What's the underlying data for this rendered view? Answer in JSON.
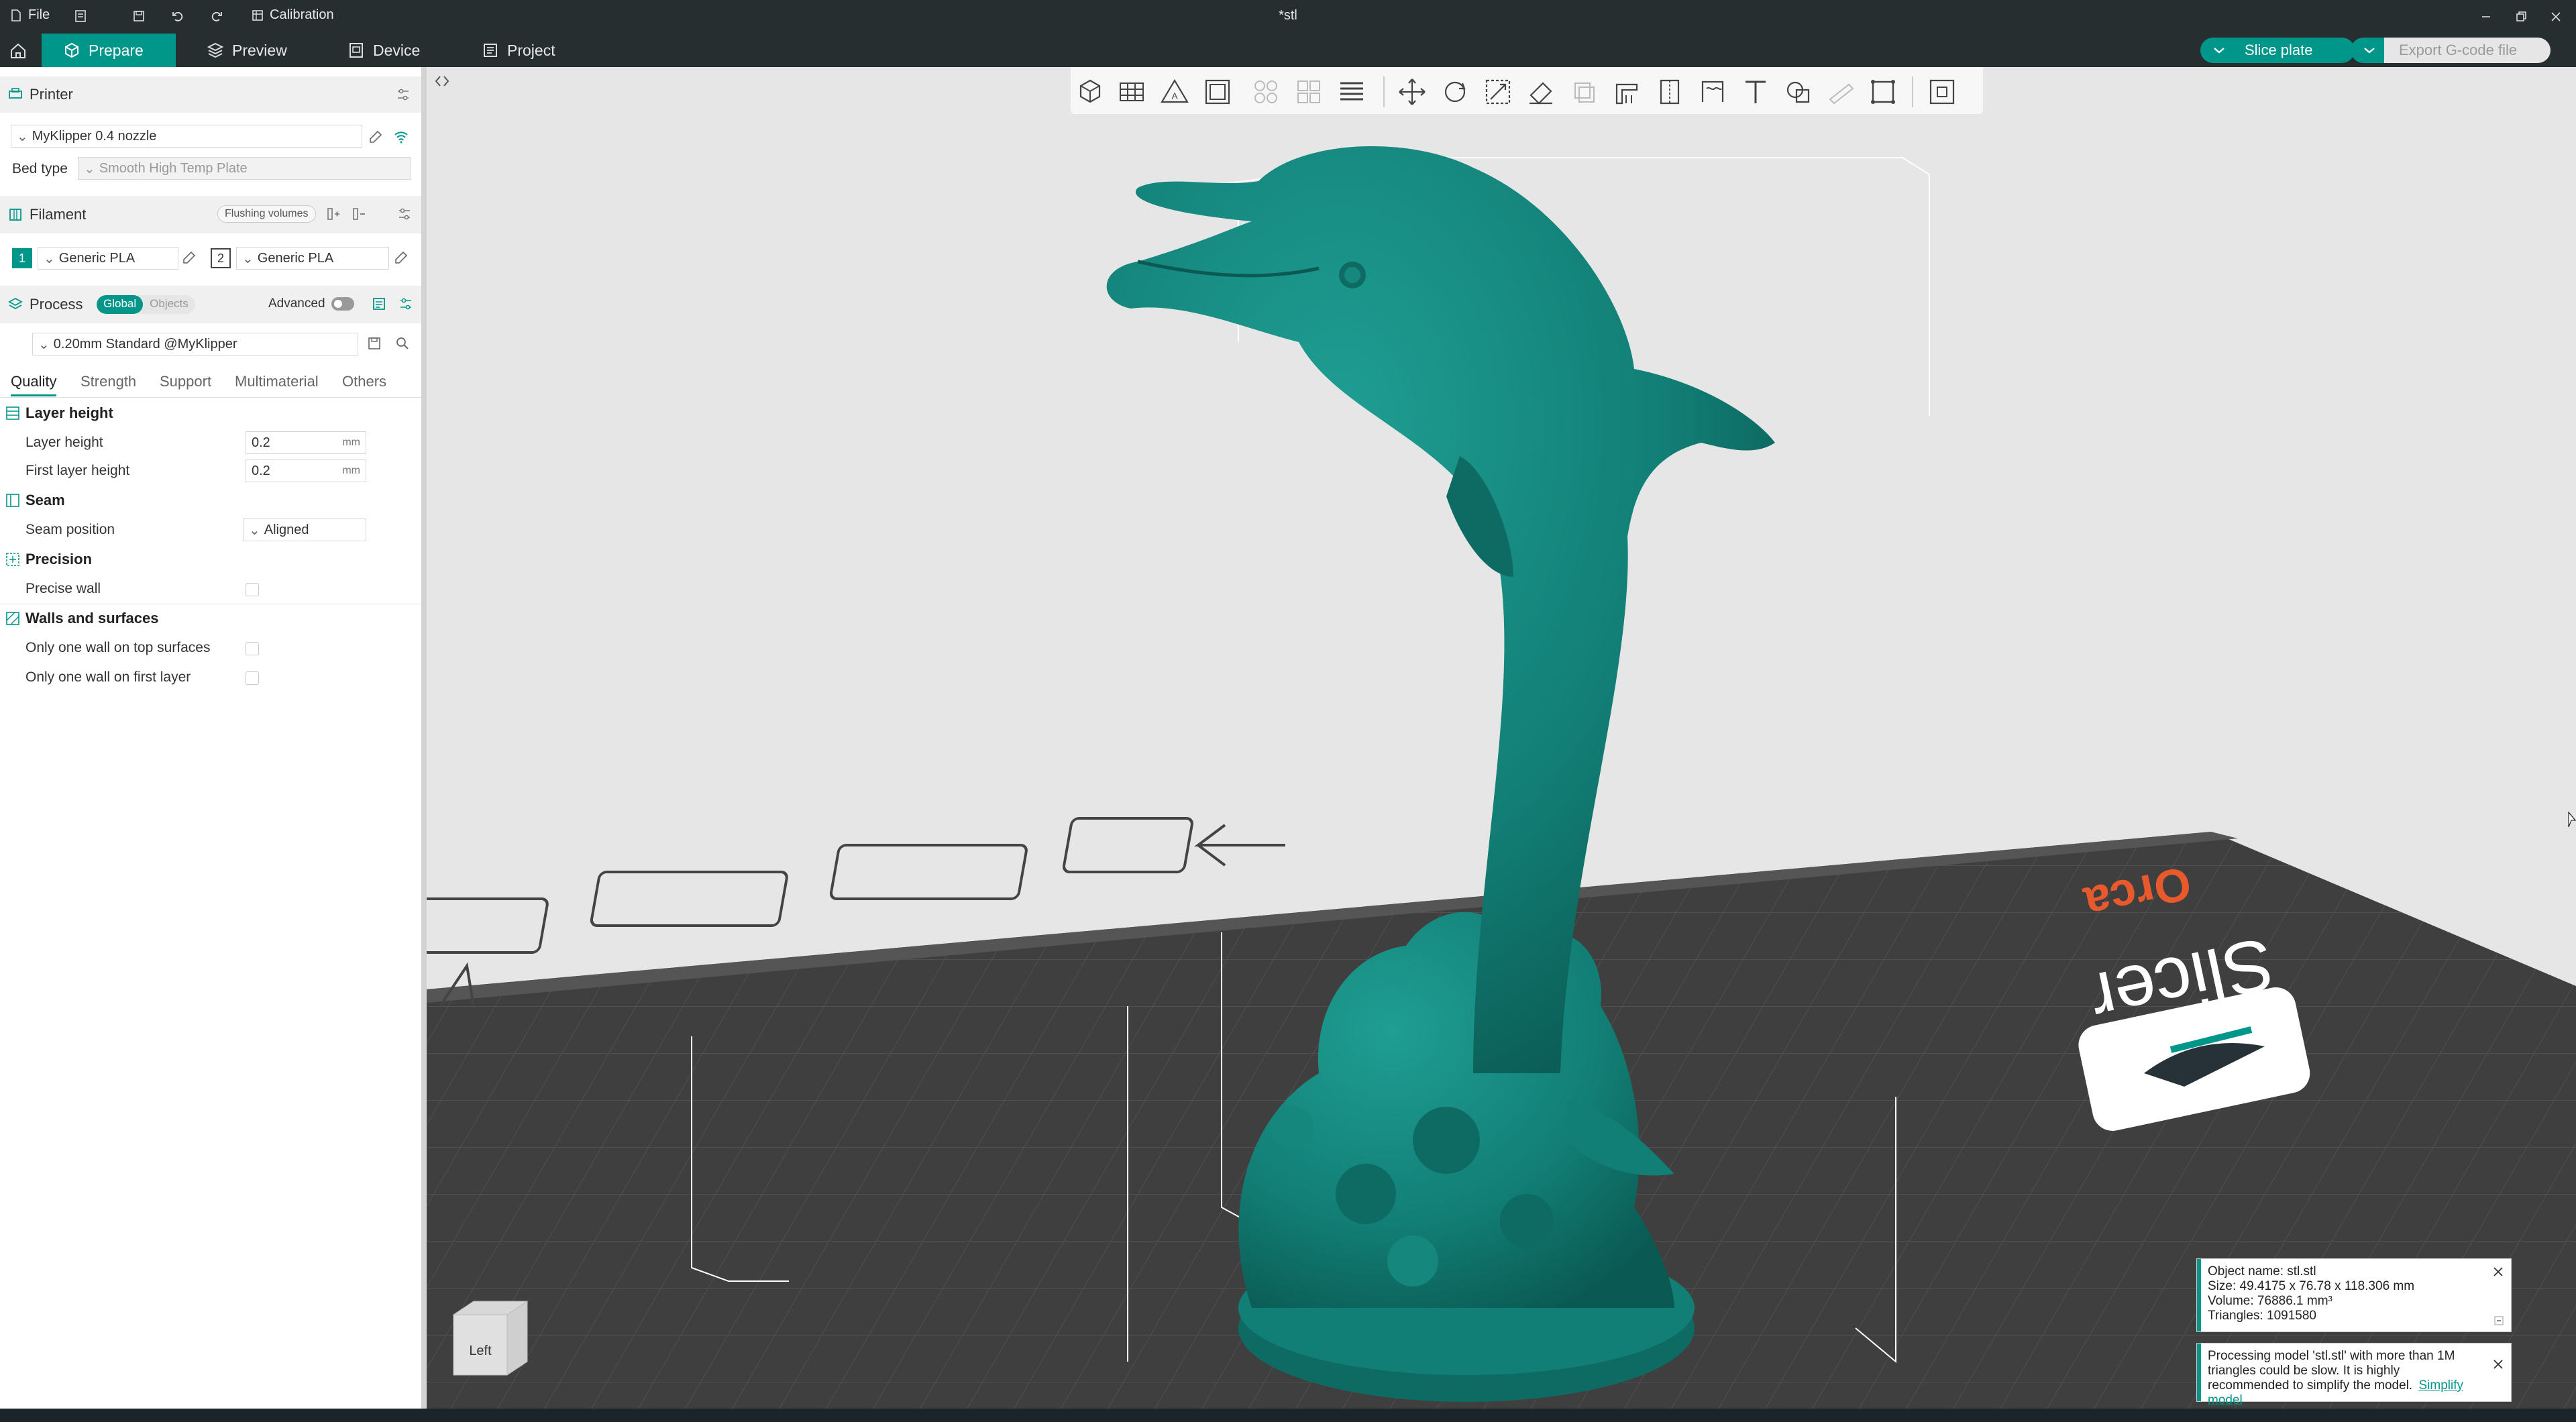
{
  "titlebar": {
    "file_label": "File",
    "calibration_label": "Calibration",
    "title": "*stl"
  },
  "tabs": [
    {
      "label": "Prepare",
      "icon": "cube-icon"
    },
    {
      "label": "Preview",
      "icon": "layers-icon"
    },
    {
      "label": "Device",
      "icon": "device-icon"
    },
    {
      "label": "Project",
      "icon": "project-icon"
    }
  ],
  "actions": {
    "slice_label": "Slice plate",
    "export_label": "Export G-code file"
  },
  "sidebar": {
    "printer": {
      "title": "Printer",
      "name": "MyKlipper 0.4 nozzle",
      "bed_type_label": "Bed type",
      "bed_type_value": "Smooth High Temp Plate"
    },
    "filament": {
      "title": "Filament",
      "flushing_label": "Flushing volumes",
      "items": [
        {
          "index": "1",
          "name": "Generic PLA"
        },
        {
          "index": "2",
          "name": "Generic PLA"
        }
      ]
    },
    "process": {
      "title": "Process",
      "global_label": "Global",
      "objects_label": "Objects",
      "advanced_label": "Advanced",
      "preset": "0.20mm Standard @MyKlipper"
    },
    "param_tabs": [
      "Quality",
      "Strength",
      "Support",
      "Multimaterial",
      "Others"
    ],
    "groups": {
      "layer_height": {
        "title": "Layer height",
        "layer_height_label": "Layer height",
        "layer_height_value": "0.2",
        "first_layer_label": "First layer height",
        "first_layer_value": "0.2",
        "unit": "mm"
      },
      "seam": {
        "title": "Seam",
        "position_label": "Seam position",
        "position_value": "Aligned"
      },
      "precision": {
        "title": "Precision",
        "precise_wall_label": "Precise wall"
      },
      "walls": {
        "title": "Walls and surfaces",
        "one_wall_top_label": "Only one wall on top surfaces",
        "one_wall_first_label": "Only one wall on first layer"
      }
    }
  },
  "viewport": {
    "view_cube_label": "Left",
    "brand_text": "Slicer",
    "brand_accent": "Orca"
  },
  "notifications": {
    "object_info": [
      "Object name: stl.stl",
      "Size: 49.4175 x 76.78 x 118.306 mm",
      "Volume: 76886.1 mm³",
      "Triangles: 1091580"
    ],
    "processing_text": "Processing model 'stl.stl' with more than 1M triangles could be slow. It is highly recommended to simplify the model.",
    "simplify_link": "Simplify model"
  },
  "colors": {
    "accent": "#00968a",
    "titlebar": "#262e30",
    "model": "#127f76"
  }
}
